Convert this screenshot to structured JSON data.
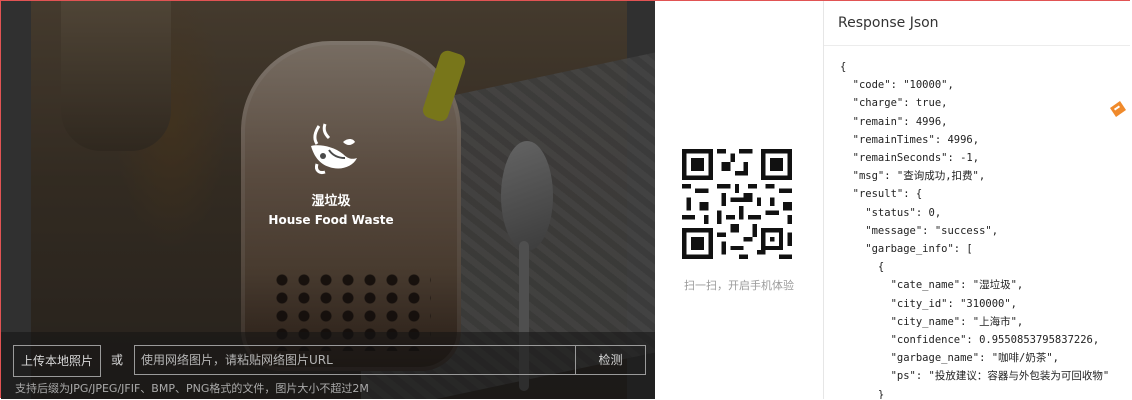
{
  "result": {
    "cate_name": "湿垃圾",
    "cate_en": "House Food Waste"
  },
  "upload": {
    "local_button": "上传本地照片",
    "or_label": "或",
    "url_placeholder": "使用网络图片，请粘贴网络图片URL",
    "detect_button": "检测",
    "tip": "支持后缀为JPG/JPEG/JFIF、BMP、PNG格式的文件，图片大小不超过2M"
  },
  "qr": {
    "caption": "扫一扫，开启手机体验"
  },
  "json_panel": {
    "title": "Response Json",
    "content": "{\n  \"code\": \"10000\",\n  \"charge\": true,\n  \"remain\": 4996,\n  \"remainTimes\": 4996,\n  \"remainSeconds\": -1,\n  \"msg\": \"查询成功,扣费\",\n  \"result\": {\n    \"status\": 0,\n    \"message\": \"success\",\n    \"garbage_info\": [\n      {\n        \"cate_name\": \"湿垃圾\",\n        \"city_id\": \"310000\",\n        \"city_name\": \"上海市\",\n        \"confidence\": 0.9550853795837226,\n        \"garbage_name\": \"咖啡/奶茶\",\n        \"ps\": \"投放建议：容器与外包装为可回收物\"\n      }"
  },
  "colors": {
    "frame": "#e15353",
    "accent_tag": "#f08a2b"
  }
}
